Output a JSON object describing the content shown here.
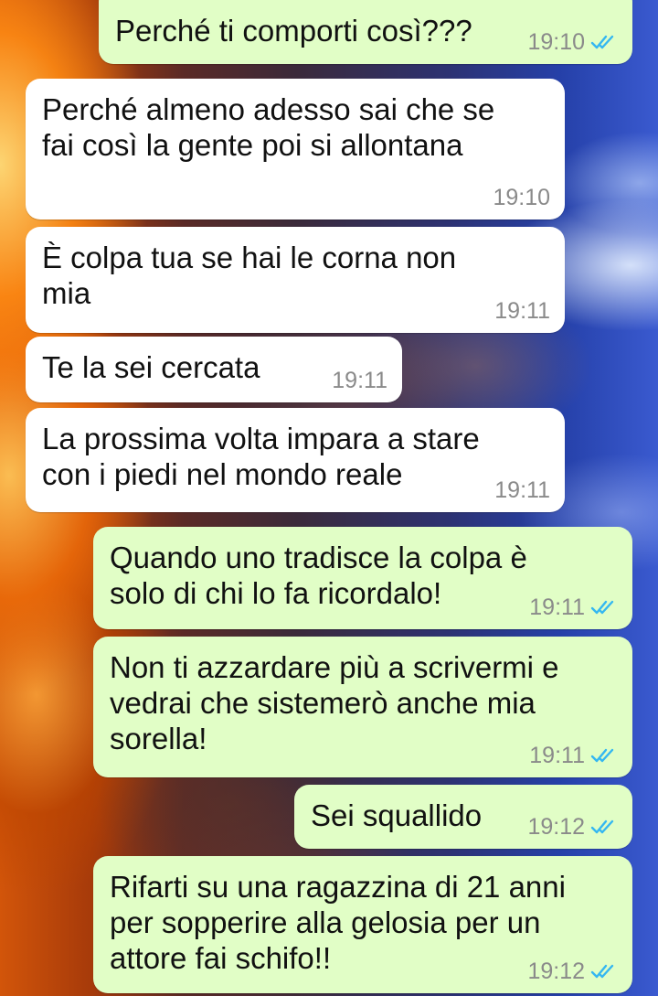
{
  "colors": {
    "incoming_bubble": "#ffffff",
    "outgoing_bubble": "#e1fec6",
    "timestamp": "#8a8a8a",
    "read_ticks": "#34b7f1"
  },
  "icons": {
    "read_receipt": "double-check-icon",
    "wallpaper": "fire-and-sky-wallpaper"
  },
  "messages": [
    {
      "direction": "outgoing",
      "text": "Perché ti comporti così???",
      "time": "19:10",
      "status": "read"
    },
    {
      "direction": "incoming",
      "text": "Perché almeno adesso sai che se\nfai così la gente poi si allontana",
      "time": "19:10"
    },
    {
      "direction": "incoming",
      "text": "È colpa tua se hai le corna non\nmia",
      "time": "19:11"
    },
    {
      "direction": "incoming",
      "text": "Te la sei cercata",
      "time": "19:11"
    },
    {
      "direction": "incoming",
      "text": "La prossima volta impara a stare\ncon i piedi nel mondo reale",
      "time": "19:11"
    },
    {
      "direction": "outgoing",
      "text": "Quando uno tradisce la colpa è\nsolo di chi lo fa ricordalo!",
      "time": "19:11",
      "status": "read"
    },
    {
      "direction": "outgoing",
      "text": "Non ti azzardare più a scrivermi e\nvedrai che sistemerò anche mia\nsorella!",
      "time": "19:11",
      "status": "read"
    },
    {
      "direction": "outgoing",
      "text": "Sei squallido",
      "time": "19:12",
      "status": "read"
    },
    {
      "direction": "outgoing",
      "text": "Rifarti su una ragazzina di 21 anni\nper sopperire alla gelosia per un\nattore fai schifo!!",
      "time": "19:12",
      "status": "read"
    }
  ]
}
